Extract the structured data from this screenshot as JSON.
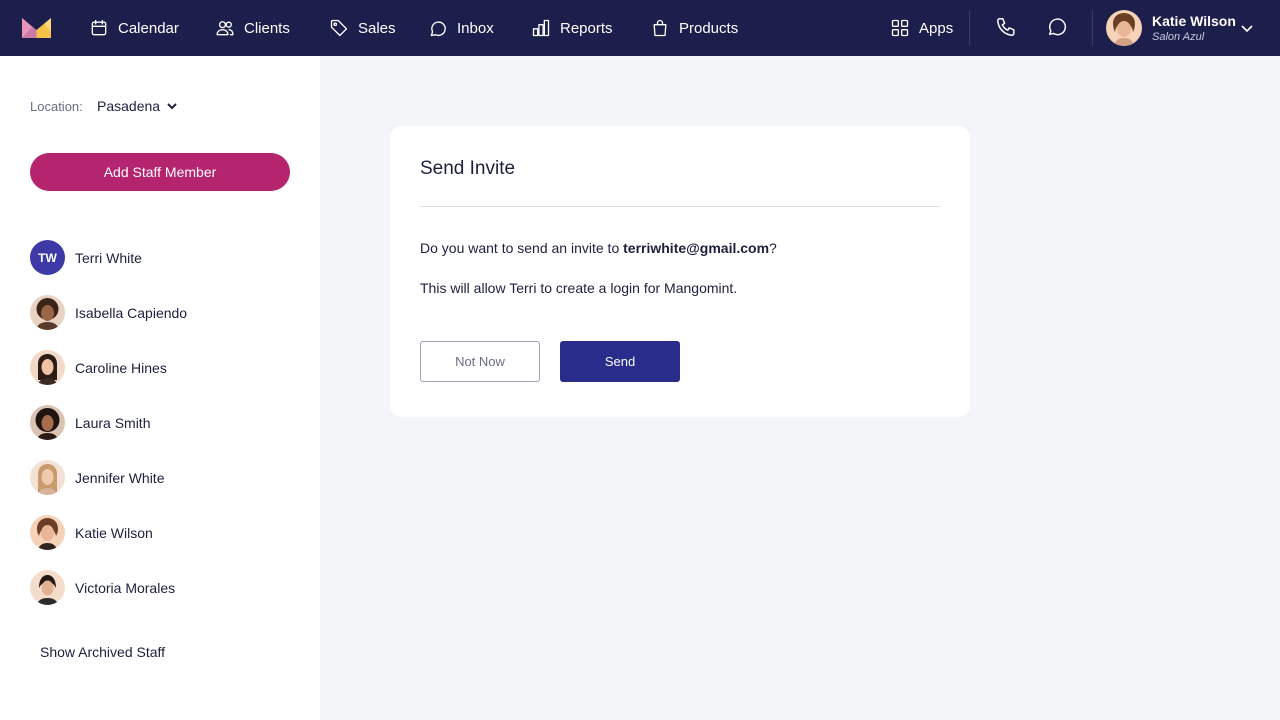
{
  "nav": {
    "items": [
      {
        "label": "Calendar",
        "icon": "calendar-icon"
      },
      {
        "label": "Clients",
        "icon": "users-icon"
      },
      {
        "label": "Sales",
        "icon": "tag-icon"
      },
      {
        "label": "Inbox",
        "icon": "chat-bubble-icon"
      },
      {
        "label": "Reports",
        "icon": "bar-chart-icon"
      },
      {
        "label": "Products",
        "icon": "shopping-bag-icon"
      }
    ],
    "apps_label": "Apps",
    "user": {
      "name": "Katie Wilson",
      "subtitle": "Salon Azul"
    }
  },
  "sidebar": {
    "location_label": "Location:",
    "location_value": "Pasadena",
    "add_button": "Add Staff Member",
    "staff": [
      {
        "name": "Terri White",
        "initials": "TW"
      },
      {
        "name": "Isabella Capiendo"
      },
      {
        "name": "Caroline Hines"
      },
      {
        "name": "Laura Smith"
      },
      {
        "name": "Jennifer White"
      },
      {
        "name": "Katie Wilson"
      },
      {
        "name": "Victoria Morales"
      }
    ],
    "archived_link": "Show Archived Staff"
  },
  "modal": {
    "title": "Send Invite",
    "line1_prefix": "Do you want to send an invite to ",
    "email": "terriwhite@gmail.com",
    "line1_suffix": "?",
    "line2": "This will allow Terri to create a login for Mangomint.",
    "cancel_label": "Not Now",
    "send_label": "Send"
  },
  "colors": {
    "nav_bg": "#1c1e4b",
    "accent_pink": "#b5246e",
    "primary_blue": "#292c8a",
    "initials_bg": "#3d3aa8"
  }
}
